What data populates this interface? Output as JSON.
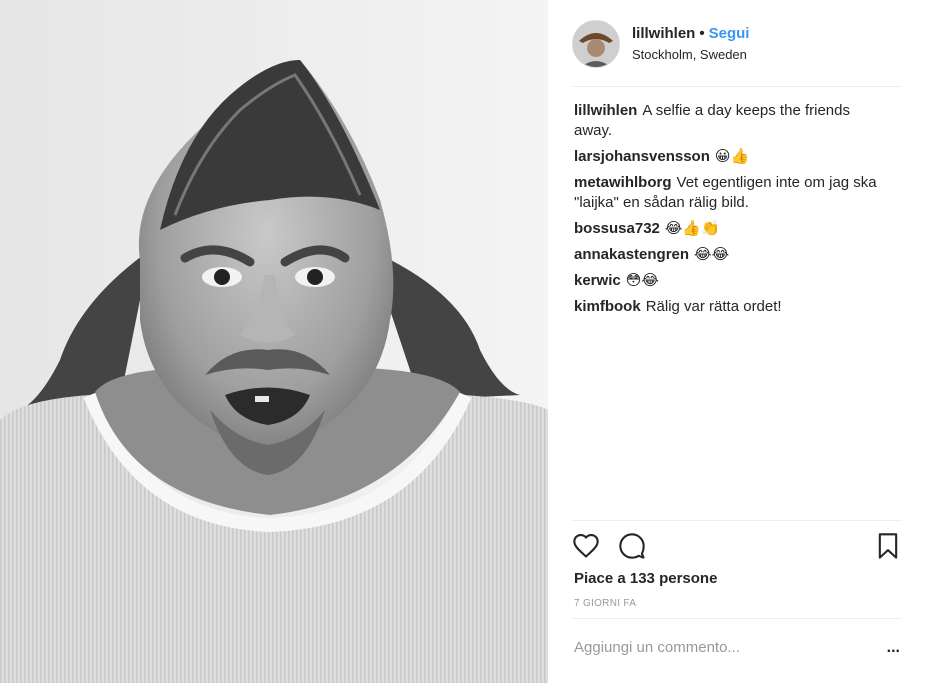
{
  "post": {
    "image_description_icon": "photo",
    "header": {
      "username": "lillwihlen",
      "separator": "•",
      "follow_label": "Segui",
      "location": "Stockholm, Sweden"
    },
    "comments": [
      {
        "user": "lillwihlen",
        "text": "A selfie a day keeps the friends away."
      },
      {
        "user": "larsjohansvensson",
        "text": "😀👍"
      },
      {
        "user": "metawihlborg",
        "text": "Vet egentligen inte om jag ska \"laijka\" en sådan rälig bild."
      },
      {
        "user": "bossusa732",
        "text": "😂👍👏"
      },
      {
        "user": "annakastengren",
        "text": "😂😂"
      },
      {
        "user": "kerwic",
        "text": "😳😂"
      },
      {
        "user": "kimfbook",
        "text": "Rälig var rätta ordet!"
      }
    ],
    "actions": {
      "like_icon": "heart-icon",
      "comment_icon": "comment-icon",
      "save_icon": "bookmark-icon"
    },
    "likes_text": "Piace a 133 persone",
    "time_text": "7 GIORNI FA",
    "add_comment_placeholder": "Aggiungi un commento...",
    "more_label": "..."
  }
}
